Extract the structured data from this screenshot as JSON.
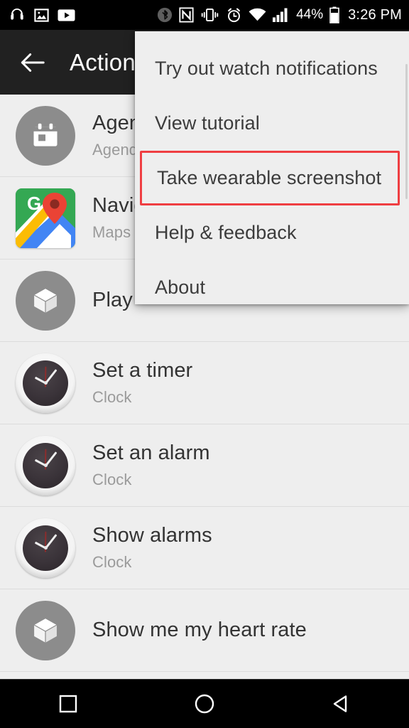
{
  "status_bar": {
    "left_icons": [
      "headphones-icon",
      "photo-icon",
      "youtube-icon"
    ],
    "right_icons": [
      "bluetooth-icon",
      "nfc-icon",
      "vibrate-icon",
      "alarm-icon",
      "wifi-icon",
      "signal-icon"
    ],
    "battery_percent": "44%",
    "time": "3:26 PM"
  },
  "app_bar": {
    "back_label": "back-arrow",
    "title": "Action"
  },
  "list": {
    "rows": [
      {
        "title": "Agen",
        "subtitle": "Agend",
        "icon": "calendar-icon"
      },
      {
        "title": "Navig",
        "subtitle": "Maps",
        "icon": "maps-icon"
      },
      {
        "title": "Play",
        "subtitle": "",
        "icon": "box-icon"
      },
      {
        "title": "Set a timer",
        "subtitle": "Clock",
        "icon": "clock-icon"
      },
      {
        "title": "Set an alarm",
        "subtitle": "Clock",
        "icon": "clock-icon"
      },
      {
        "title": "Show alarms",
        "subtitle": "Clock",
        "icon": "clock-icon"
      },
      {
        "title": "Show me my heart rate",
        "subtitle": "",
        "icon": "box-icon"
      }
    ]
  },
  "menu": {
    "items": [
      {
        "label": "Try out watch notifications",
        "highlighted": false
      },
      {
        "label": "View tutorial",
        "highlighted": false
      },
      {
        "label": "Take wearable screenshot",
        "highlighted": true
      },
      {
        "label": "Help & feedback",
        "highlighted": false
      },
      {
        "label": "About",
        "highlighted": false
      }
    ],
    "highlight_color": "#ef3e42"
  },
  "nav_bar": {
    "buttons": [
      "recents-square-icon",
      "home-circle-icon",
      "back-triangle-icon"
    ]
  }
}
